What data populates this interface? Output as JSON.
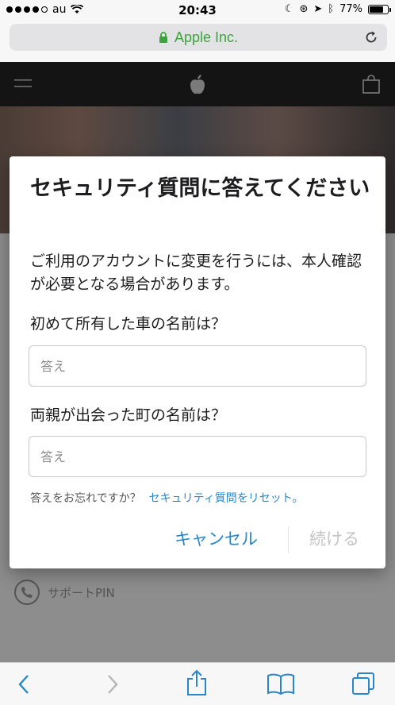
{
  "status": {
    "carrier": "au",
    "time": "20:43",
    "battery": "77%",
    "battery_level": 0.77
  },
  "browser": {
    "url_display": "Apple Inc."
  },
  "dialog": {
    "title": "セキュリティ質問に答えてください",
    "description": "ご利用のアカウントに変更を行うには、本人確認が必要となる場合があります。",
    "question1": "初めて所有した車の名前は？",
    "answer1_placeholder": "答え",
    "question2": "両親が出会った町の名前は？",
    "answer2_placeholder": "答え",
    "forgot_text": "答えをお忘れですか？",
    "reset_link": "セキュリティ質問をリセット。",
    "cancel_label": "キャンセル",
    "continue_label": "続ける"
  },
  "page": {
    "support_label": "サポートPIN"
  },
  "colors": {
    "accent": "#2a86c8",
    "url_green": "#3ea33e"
  }
}
